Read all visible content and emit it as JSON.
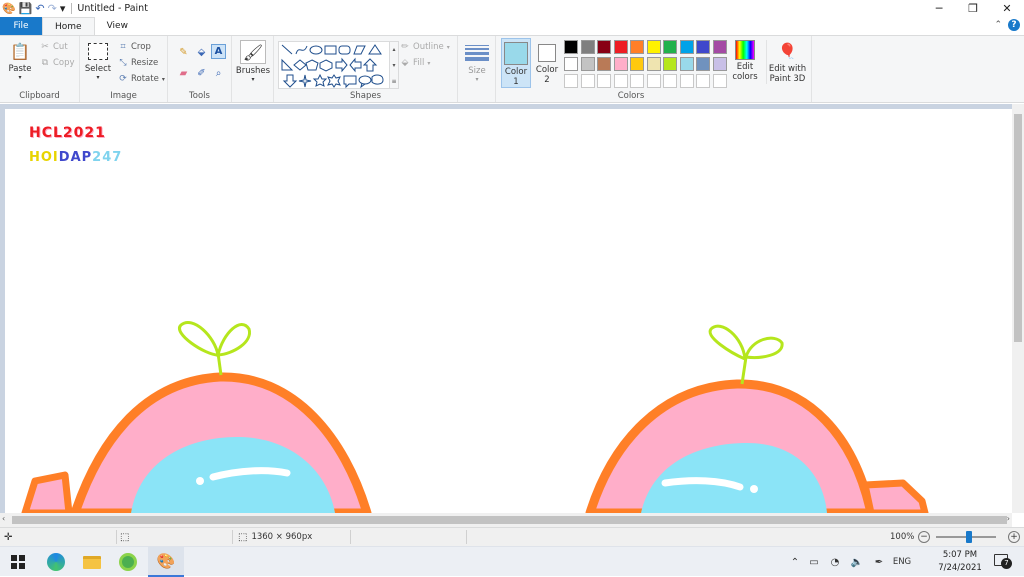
{
  "window": {
    "title": "Untitled - Paint",
    "quick_access_dropdown": "▾"
  },
  "tabs": [
    {
      "label": "File"
    },
    {
      "label": "Home"
    },
    {
      "label": "View"
    }
  ],
  "ribbon": {
    "clipboard": {
      "group_label": "Clipboard",
      "paste": "Paste",
      "cut": "Cut",
      "copy": "Copy"
    },
    "image": {
      "group_label": "Image",
      "select": "Select",
      "crop": "Crop",
      "resize": "Resize",
      "rotate": "Rotate"
    },
    "tools": {
      "group_label": "Tools"
    },
    "brushes": {
      "label": "Brushes"
    },
    "shapes": {
      "group_label": "Shapes",
      "outline": "Outline",
      "fill": "Fill"
    },
    "size": {
      "label": "Size"
    },
    "colors": {
      "group_label": "Colors",
      "color1": "Color",
      "color1_num": "1",
      "color2": "Color",
      "color2_num": "2",
      "edit_colors": "Edit",
      "edit_colors_2": "colors",
      "edit_paint3d": "Edit with",
      "edit_paint3d_2": "Paint 3D",
      "color1_value": "#99d9ea",
      "color2_value": "#ffffff",
      "palette_row1": [
        "#000000",
        "#7f7f7f",
        "#880015",
        "#ed1c24",
        "#ff7f27",
        "#fff200",
        "#22b14c",
        "#00a2e8",
        "#3f48cc",
        "#a349a4"
      ],
      "palette_row2": [
        "#ffffff",
        "#c3c3c3",
        "#b97a57",
        "#ffaec9",
        "#ffc90e",
        "#efe4b0",
        "#b5e61d",
        "#99d9ea",
        "#7092be",
        "#c8bfe7"
      ]
    }
  },
  "canvas": {
    "text_line1": "HCL2021",
    "text_line2_a": "HOI",
    "text_line2_b": "DAP",
    "text_line2_c": "247"
  },
  "status": {
    "canvas_size": "1360 × 960px",
    "zoom": "100%"
  },
  "taskbar": {
    "language": "ENG",
    "time": "5:07 PM",
    "date": "7/24/2021",
    "notification_count": "7"
  }
}
